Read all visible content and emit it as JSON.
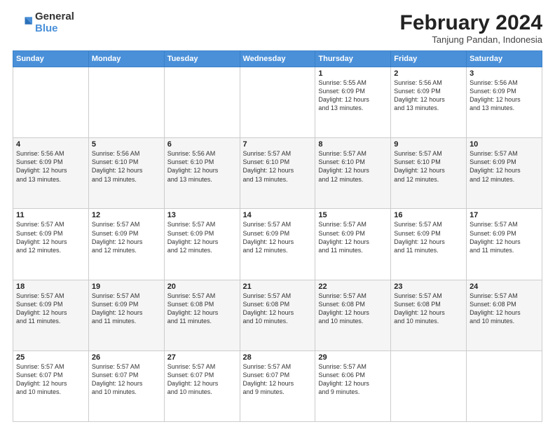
{
  "logo": {
    "general": "General",
    "blue": "Blue"
  },
  "header": {
    "month": "February 2024",
    "location": "Tanjung Pandan, Indonesia"
  },
  "days": [
    "Sunday",
    "Monday",
    "Tuesday",
    "Wednesday",
    "Thursday",
    "Friday",
    "Saturday"
  ],
  "weeks": [
    [
      {
        "day": "",
        "info": ""
      },
      {
        "day": "",
        "info": ""
      },
      {
        "day": "",
        "info": ""
      },
      {
        "day": "",
        "info": ""
      },
      {
        "day": "1",
        "info": "Sunrise: 5:55 AM\nSunset: 6:09 PM\nDaylight: 12 hours\nand 13 minutes."
      },
      {
        "day": "2",
        "info": "Sunrise: 5:56 AM\nSunset: 6:09 PM\nDaylight: 12 hours\nand 13 minutes."
      },
      {
        "day": "3",
        "info": "Sunrise: 5:56 AM\nSunset: 6:09 PM\nDaylight: 12 hours\nand 13 minutes."
      }
    ],
    [
      {
        "day": "4",
        "info": "Sunrise: 5:56 AM\nSunset: 6:09 PM\nDaylight: 12 hours\nand 13 minutes."
      },
      {
        "day": "5",
        "info": "Sunrise: 5:56 AM\nSunset: 6:10 PM\nDaylight: 12 hours\nand 13 minutes."
      },
      {
        "day": "6",
        "info": "Sunrise: 5:56 AM\nSunset: 6:10 PM\nDaylight: 12 hours\nand 13 minutes."
      },
      {
        "day": "7",
        "info": "Sunrise: 5:57 AM\nSunset: 6:10 PM\nDaylight: 12 hours\nand 13 minutes."
      },
      {
        "day": "8",
        "info": "Sunrise: 5:57 AM\nSunset: 6:10 PM\nDaylight: 12 hours\nand 12 minutes."
      },
      {
        "day": "9",
        "info": "Sunrise: 5:57 AM\nSunset: 6:10 PM\nDaylight: 12 hours\nand 12 minutes."
      },
      {
        "day": "10",
        "info": "Sunrise: 5:57 AM\nSunset: 6:09 PM\nDaylight: 12 hours\nand 12 minutes."
      }
    ],
    [
      {
        "day": "11",
        "info": "Sunrise: 5:57 AM\nSunset: 6:09 PM\nDaylight: 12 hours\nand 12 minutes."
      },
      {
        "day": "12",
        "info": "Sunrise: 5:57 AM\nSunset: 6:09 PM\nDaylight: 12 hours\nand 12 minutes."
      },
      {
        "day": "13",
        "info": "Sunrise: 5:57 AM\nSunset: 6:09 PM\nDaylight: 12 hours\nand 12 minutes."
      },
      {
        "day": "14",
        "info": "Sunrise: 5:57 AM\nSunset: 6:09 PM\nDaylight: 12 hours\nand 12 minutes."
      },
      {
        "day": "15",
        "info": "Sunrise: 5:57 AM\nSunset: 6:09 PM\nDaylight: 12 hours\nand 11 minutes."
      },
      {
        "day": "16",
        "info": "Sunrise: 5:57 AM\nSunset: 6:09 PM\nDaylight: 12 hours\nand 11 minutes."
      },
      {
        "day": "17",
        "info": "Sunrise: 5:57 AM\nSunset: 6:09 PM\nDaylight: 12 hours\nand 11 minutes."
      }
    ],
    [
      {
        "day": "18",
        "info": "Sunrise: 5:57 AM\nSunset: 6:09 PM\nDaylight: 12 hours\nand 11 minutes."
      },
      {
        "day": "19",
        "info": "Sunrise: 5:57 AM\nSunset: 6:09 PM\nDaylight: 12 hours\nand 11 minutes."
      },
      {
        "day": "20",
        "info": "Sunrise: 5:57 AM\nSunset: 6:08 PM\nDaylight: 12 hours\nand 11 minutes."
      },
      {
        "day": "21",
        "info": "Sunrise: 5:57 AM\nSunset: 6:08 PM\nDaylight: 12 hours\nand 10 minutes."
      },
      {
        "day": "22",
        "info": "Sunrise: 5:57 AM\nSunset: 6:08 PM\nDaylight: 12 hours\nand 10 minutes."
      },
      {
        "day": "23",
        "info": "Sunrise: 5:57 AM\nSunset: 6:08 PM\nDaylight: 12 hours\nand 10 minutes."
      },
      {
        "day": "24",
        "info": "Sunrise: 5:57 AM\nSunset: 6:08 PM\nDaylight: 12 hours\nand 10 minutes."
      }
    ],
    [
      {
        "day": "25",
        "info": "Sunrise: 5:57 AM\nSunset: 6:07 PM\nDaylight: 12 hours\nand 10 minutes."
      },
      {
        "day": "26",
        "info": "Sunrise: 5:57 AM\nSunset: 6:07 PM\nDaylight: 12 hours\nand 10 minutes."
      },
      {
        "day": "27",
        "info": "Sunrise: 5:57 AM\nSunset: 6:07 PM\nDaylight: 12 hours\nand 10 minutes."
      },
      {
        "day": "28",
        "info": "Sunrise: 5:57 AM\nSunset: 6:07 PM\nDaylight: 12 hours\nand 9 minutes."
      },
      {
        "day": "29",
        "info": "Sunrise: 5:57 AM\nSunset: 6:06 PM\nDaylight: 12 hours\nand 9 minutes."
      },
      {
        "day": "",
        "info": ""
      },
      {
        "day": "",
        "info": ""
      }
    ]
  ]
}
